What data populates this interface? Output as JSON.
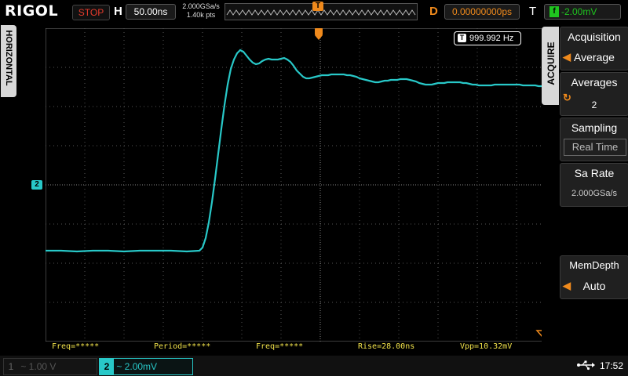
{
  "brand": "RIGOL",
  "top": {
    "run_status": "STOP",
    "h_label": "H",
    "timebase": "50.00ns",
    "sample_rate": "2.000GSa/s",
    "points": "1.40k pts",
    "d_label": "D",
    "delay": "0.00000000ps",
    "t_label": "T",
    "trigger_level": "-2.00mV"
  },
  "side_tab": "HORIZONTAL",
  "freq_counter": "999.992 Hz",
  "ch2_marker": "2",
  "measurements": [
    {
      "text": "Freq=*****"
    },
    {
      "text": "Period=*****"
    },
    {
      "text": "Freq=*****"
    },
    {
      "text": "Rise=28.00ns"
    },
    {
      "text": "Vpp=10.32mV"
    }
  ],
  "menu": {
    "title": "ACQUIRE",
    "items": [
      {
        "label": "Acquisition",
        "value": "Average"
      },
      {
        "label": "Averages",
        "value": "2"
      },
      {
        "label": "Sampling",
        "value": "Real Time"
      },
      {
        "label": "Sa Rate",
        "value": "2.000GSa/s"
      },
      {
        "label": "MemDepth",
        "value": "Auto"
      }
    ]
  },
  "channels": {
    "ch1": {
      "num": "1",
      "text": "~ 1.00 V"
    },
    "ch2": {
      "num": "2",
      "text": "~ 2.00mV"
    }
  },
  "clock": "17:52",
  "colors": {
    "trace": "#28c8c8",
    "trigger": "#f08a1c",
    "measure": "#f1e24a",
    "stop": "#e53b2c"
  }
}
